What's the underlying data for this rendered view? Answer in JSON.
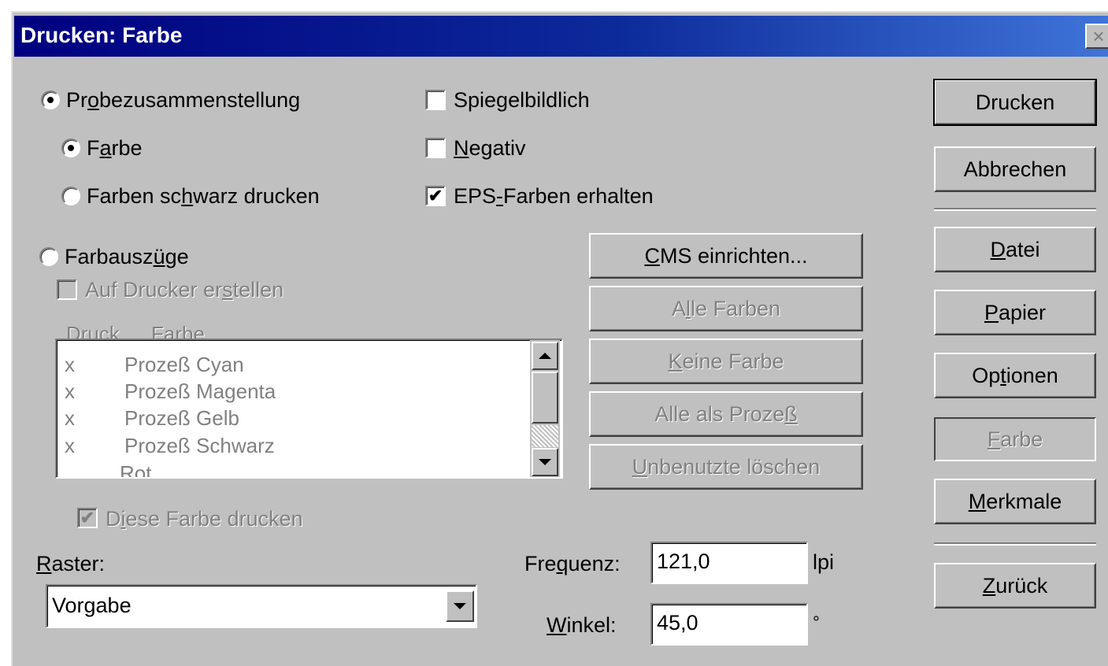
{
  "window": {
    "title": "Drucken: Farbe",
    "close_glyph": "×"
  },
  "options": {
    "probe": {
      "prefix": "Pr",
      "u": "o",
      "suffix": "bezusammenstellung",
      "selected": true
    },
    "farbe": {
      "prefix": "F",
      "u": "a",
      "suffix": "rbe",
      "selected": true
    },
    "schwarz": {
      "prefix": "Farben sc",
      "u": "h",
      "suffix": "warz drucken",
      "selected": false
    },
    "farbauszuege": {
      "prefix": "Farbausz",
      "u": "ü",
      "suffix": "ge",
      "selected": false
    },
    "auf_drucker": {
      "prefix": "Auf Drucker er",
      "u": "s",
      "suffix": "tellen",
      "checked": false
    },
    "spiegel": {
      "prefix": "Spie",
      "u": "g",
      "suffix": "elbildlich",
      "checked": false
    },
    "negativ": {
      "prefix": "",
      "u": "N",
      "suffix": "egativ",
      "checked": false
    },
    "eps": {
      "prefix": "EPS",
      "u": "-",
      "suffix": "Farben erhalten",
      "checked": true
    }
  },
  "list": {
    "header_druck": "Druck",
    "header_farbe_prefix": "Far",
    "header_farbe_u": "b",
    "header_farbe_suffix": "e",
    "rows": [
      {
        "mark": "x",
        "name": "Prozeß Cyan"
      },
      {
        "mark": "x",
        "name": "Prozeß Magenta"
      },
      {
        "mark": "x",
        "name": "Prozeß Gelb"
      },
      {
        "mark": "x",
        "name": "Prozeß Schwarz"
      },
      {
        "mark": "",
        "name": "Rot"
      }
    ]
  },
  "diese_farbe": {
    "prefix": "D",
    "u": "i",
    "suffix": "ese Farbe drucken",
    "checked": true
  },
  "color_buttons": {
    "cms": {
      "prefix": "",
      "u": "C",
      "suffix": "MS einrichten..."
    },
    "alle": {
      "prefix": "A",
      "u": "l",
      "suffix": "le Farben"
    },
    "keine": {
      "prefix": "",
      "u": "K",
      "suffix": "eine Farbe"
    },
    "prozess": {
      "prefix": "Alle als Proze",
      "u": "ß",
      "suffix": ""
    },
    "unbenutzte": {
      "prefix": "",
      "u": "U",
      "suffix": "nbenutzte löschen"
    }
  },
  "raster": {
    "label_u": "R",
    "label_suffix": "aster:",
    "value": "Vorgabe"
  },
  "frequenz": {
    "label_prefix": "Fre",
    "label_u": "q",
    "label_suffix": "uenz:",
    "value": "121,0",
    "unit": "lpi"
  },
  "winkel": {
    "label_prefix": "",
    "label_u": "W",
    "label_suffix": "inkel:",
    "value": "45,0",
    "unit": "°"
  },
  "side_buttons": {
    "drucken": "Drucken",
    "abbrechen": "Abbrechen",
    "datei": {
      "prefix": "",
      "u": "D",
      "suffix": "atei"
    },
    "papier": {
      "prefix": "",
      "u": "P",
      "suffix": "apier"
    },
    "optionen": {
      "prefix": "Op",
      "u": "t",
      "suffix": "ionen"
    },
    "farbe": {
      "prefix": "",
      "u": "F",
      "suffix": "arbe"
    },
    "merkmale": {
      "prefix": "",
      "u": "M",
      "suffix": "erkmale"
    },
    "zurueck": {
      "prefix": "",
      "u": "Z",
      "suffix": "urück"
    }
  }
}
